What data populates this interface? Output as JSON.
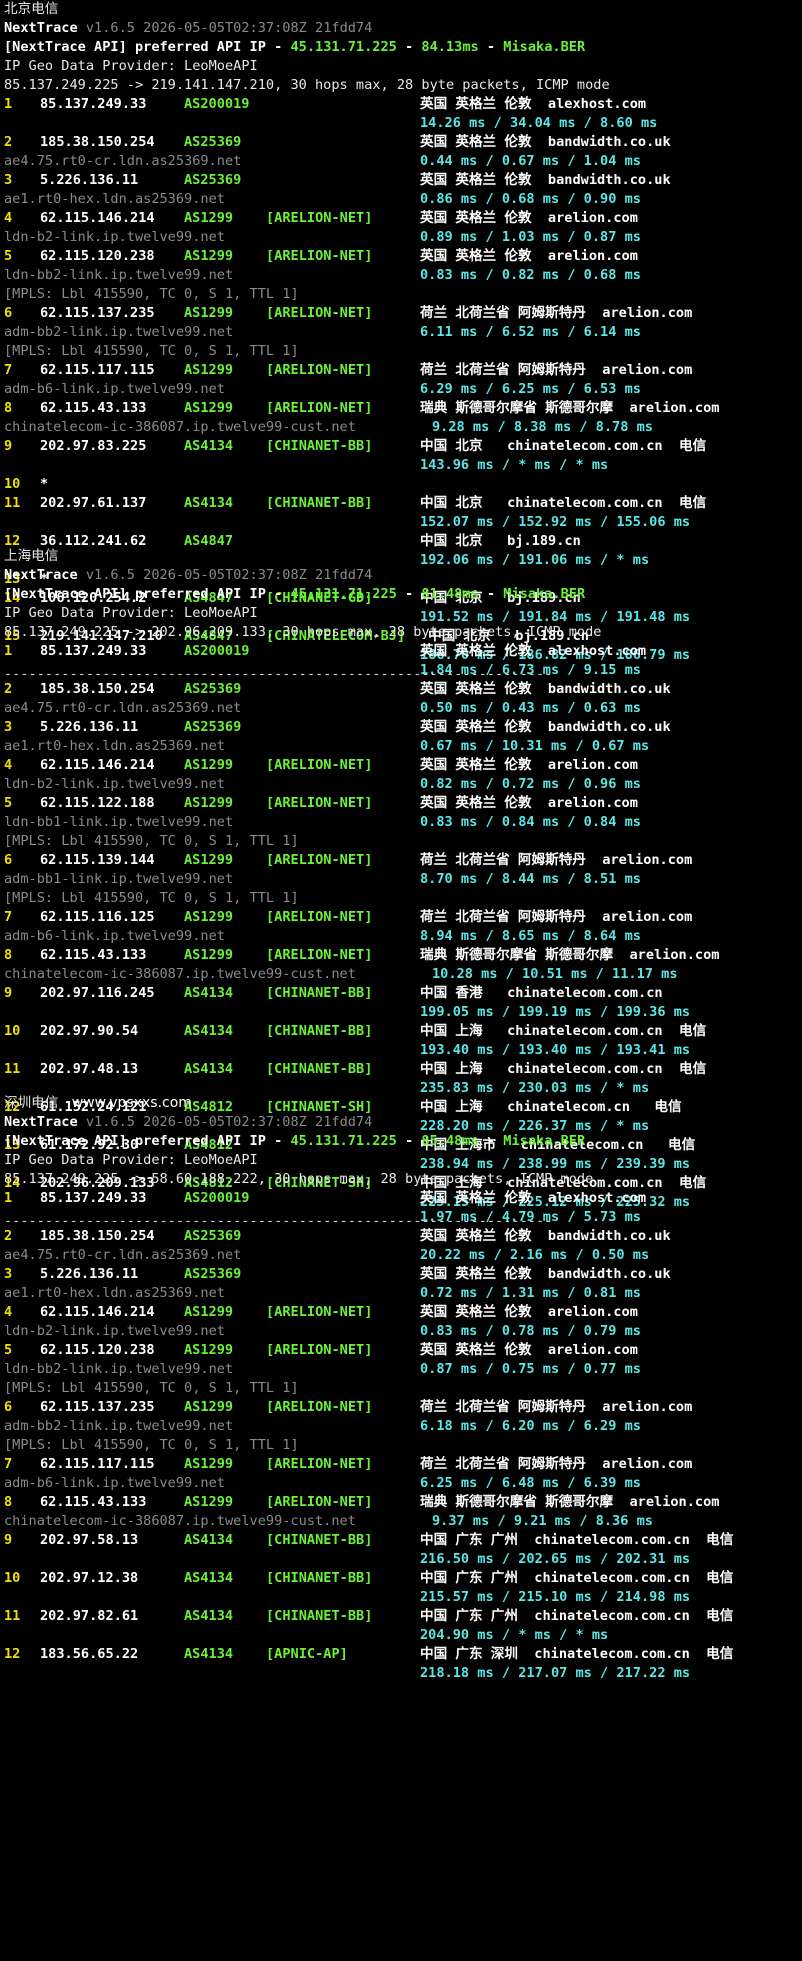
{
  "sections": [
    {
      "title": "北京电信",
      "header_app": "NextTrace",
      "header_meta": "v1.6.5 2026-05-05T02:37:08Z 21fdd74",
      "api_prefix": "[NextTrace API] preferred API IP - ",
      "api_ip": "45.131.71.225",
      "api_dash": " - ",
      "api_ms": "84.13ms",
      "api_dash2": " - ",
      "api_node": "Misaka.BER",
      "geo_provider": "IP Geo Data Provider: LeoMoeAPI",
      "trace_line": "85.137.249.225 -> 219.141.147.210, 30 hops max, 28 byte packets, ICMP mode",
      "hops": [
        {
          "n": "1",
          "ip": "85.137.249.33",
          "as": "AS200019",
          "net": "",
          "geo": "英国 英格兰 伦敦  alexhost.com",
          "rtt": "14.26 ms / 34.04 ms / 8.60 ms",
          "host": ""
        },
        {
          "n": "2",
          "ip": "185.38.150.254",
          "as": "AS25369",
          "net": "",
          "geo": "英国 英格兰 伦敦  bandwidth.co.uk",
          "rtt": "0.44 ms / 0.67 ms / 1.04 ms",
          "host": "ae4.75.rt0-cr.ldn.as25369.net"
        },
        {
          "n": "3",
          "ip": "5.226.136.11",
          "as": "AS25369",
          "net": "",
          "geo": "英国 英格兰 伦敦  bandwidth.co.uk",
          "rtt": "0.86 ms / 0.68 ms / 0.90 ms",
          "host": "ae1.rt0-hex.ldn.as25369.net"
        },
        {
          "n": "4",
          "ip": "62.115.146.214",
          "as": "AS1299",
          "net": "[ARELION-NET]",
          "geo": "英国 英格兰 伦敦  arelion.com",
          "rtt": "0.89 ms / 1.03 ms / 0.87 ms",
          "host": "ldn-b2-link.ip.twelve99.net"
        },
        {
          "n": "5",
          "ip": "62.115.120.238",
          "as": "AS1299",
          "net": "[ARELION-NET]",
          "geo": "英国 英格兰 伦敦  arelion.com",
          "rtt": "0.83 ms / 0.82 ms / 0.68 ms",
          "host": "ldn-bb2-link.ip.twelve99.net",
          "mpls": "[MPLS: Lbl 415590, TC 0, S 1, TTL 1]"
        },
        {
          "n": "6",
          "ip": "62.115.137.235",
          "as": "AS1299",
          "net": "[ARELION-NET]",
          "geo": "荷兰 北荷兰省 阿姆斯特丹  arelion.com",
          "rtt": "6.11 ms / 6.52 ms / 6.14 ms",
          "host": "adm-bb2-link.ip.twelve99.net",
          "mpls": "[MPLS: Lbl 415590, TC 0, S 1, TTL 1]"
        },
        {
          "n": "7",
          "ip": "62.115.117.115",
          "as": "AS1299",
          "net": "[ARELION-NET]",
          "geo": "荷兰 北荷兰省 阿姆斯特丹  arelion.com",
          "rtt": "6.29 ms / 6.25 ms / 6.53 ms",
          "host": "adm-b6-link.ip.twelve99.net"
        },
        {
          "n": "8",
          "ip": "62.115.43.133",
          "as": "AS1299",
          "net": "[ARELION-NET]",
          "geo": "瑞典 斯德哥尔摩省 斯德哥尔摩  arelion.com",
          "rtt": "9.28 ms / 8.38 ms / 8.78 ms",
          "host": "chinatelecom-ic-386087.ip.twelve99-cust.net",
          "inline": true
        },
        {
          "n": "9",
          "ip": "202.97.83.225",
          "as": "AS4134",
          "net": "[CHINANET-BB]",
          "geo": "中国 北京   chinatelecom.com.cn  电信",
          "rtt": "143.96 ms / * ms / * ms",
          "host": ""
        },
        {
          "n": "10",
          "ip": "*",
          "as": "",
          "net": "",
          "geo": "",
          "rtt": "",
          "host": ""
        },
        {
          "n": "11",
          "ip": "202.97.61.137",
          "as": "AS4134",
          "net": "[CHINANET-BB]",
          "geo": "中国 北京   chinatelecom.com.cn  电信",
          "rtt": "152.07 ms / 152.92 ms / 155.06 ms",
          "host": ""
        },
        {
          "n": "12",
          "ip": "36.112.241.62",
          "as": "AS4847",
          "net": "",
          "geo": "中国 北京   bj.189.cn",
          "rtt": "192.06 ms / 191.06 ms / * ms",
          "host": ""
        },
        {
          "n": "13",
          "ip": "*",
          "as": "",
          "net": "",
          "geo": "",
          "rtt": "",
          "host": ""
        },
        {
          "n": "14",
          "ip": "106.120.254.2",
          "as": "AS4847",
          "net": "[CHINANET-GD]",
          "geo": "中国 北京   bj.189.cn",
          "rtt": "191.52 ms / 191.84 ms / 191.48 ms",
          "host": ""
        },
        {
          "n": "15",
          "ip": "219.141.147.210",
          "as": "AS4847",
          "net": "[CHINATELECOM-BJ]",
          "geo": " 中国 北京   bj.189.cn",
          "rtt": "186.70 ms / 186.82 ms / 186.79 ms",
          "host": ""
        }
      ]
    },
    {
      "title": "上海电信",
      "header_app": "NextTrace",
      "header_meta": "v1.6.5 2026-05-05T02:37:08Z 21fdd74",
      "api_prefix": "[NextTrace API] preferred API IP - ",
      "api_ip": "45.131.71.225",
      "api_dash": " - ",
      "api_ms": "81.48ms",
      "api_dash2": " - ",
      "api_node": "Misaka.BER",
      "geo_provider": "IP Geo Data Provider: LeoMoeAPI",
      "trace_line": "85.137.249.225 -> 202.96.209.133, 30 hops max, 28 byte packets, ICMP mode",
      "hops": [
        {
          "n": "1",
          "ip": "85.137.249.33",
          "as": "AS200019",
          "net": "",
          "geo": "英国 英格兰 伦敦  alexhost.com",
          "rtt": "1.84 ms / 6.73 ms / 9.15 ms",
          "host": ""
        },
        {
          "n": "2",
          "ip": "185.38.150.254",
          "as": "AS25369",
          "net": "",
          "geo": "英国 英格兰 伦敦  bandwidth.co.uk",
          "rtt": "0.50 ms / 0.43 ms / 0.63 ms",
          "host": "ae4.75.rt0-cr.ldn.as25369.net"
        },
        {
          "n": "3",
          "ip": "5.226.136.11",
          "as": "AS25369",
          "net": "",
          "geo": "英国 英格兰 伦敦  bandwidth.co.uk",
          "rtt": "0.67 ms / 10.31 ms / 0.67 ms",
          "host": "ae1.rt0-hex.ldn.as25369.net"
        },
        {
          "n": "4",
          "ip": "62.115.146.214",
          "as": "AS1299",
          "net": "[ARELION-NET]",
          "geo": "英国 英格兰 伦敦  arelion.com",
          "rtt": "0.82 ms / 0.72 ms / 0.96 ms",
          "host": "ldn-b2-link.ip.twelve99.net"
        },
        {
          "n": "5",
          "ip": "62.115.122.188",
          "as": "AS1299",
          "net": "[ARELION-NET]",
          "geo": "英国 英格兰 伦敦  arelion.com",
          "rtt": "0.83 ms / 0.84 ms / 0.84 ms",
          "host": "ldn-bb1-link.ip.twelve99.net",
          "mpls": "[MPLS: Lbl 415590, TC 0, S 1, TTL 1]"
        },
        {
          "n": "6",
          "ip": "62.115.139.144",
          "as": "AS1299",
          "net": "[ARELION-NET]",
          "geo": "荷兰 北荷兰省 阿姆斯特丹  arelion.com",
          "rtt": "8.70 ms / 8.44 ms / 8.51 ms",
          "host": "adm-bb1-link.ip.twelve99.net",
          "mpls": "[MPLS: Lbl 415590, TC 0, S 1, TTL 1]"
        },
        {
          "n": "7",
          "ip": "62.115.116.125",
          "as": "AS1299",
          "net": "[ARELION-NET]",
          "geo": "荷兰 北荷兰省 阿姆斯特丹  arelion.com",
          "rtt": "8.94 ms / 8.65 ms / 8.64 ms",
          "host": "adm-b6-link.ip.twelve99.net"
        },
        {
          "n": "8",
          "ip": "62.115.43.133",
          "as": "AS1299",
          "net": "[ARELION-NET]",
          "geo": "瑞典 斯德哥尔摩省 斯德哥尔摩  arelion.com",
          "rtt": "10.28 ms / 10.51 ms / 11.17 ms",
          "host": "chinatelecom-ic-386087.ip.twelve99-cust.net",
          "inline": true
        },
        {
          "n": "9",
          "ip": "202.97.116.245",
          "as": "AS4134",
          "net": "[CHINANET-BB]",
          "geo": "中国 香港   chinatelecom.com.cn",
          "rtt": "199.05 ms / 199.19 ms / 199.36 ms",
          "host": ""
        },
        {
          "n": "10",
          "ip": "202.97.90.54",
          "as": "AS4134",
          "net": "[CHINANET-BB]",
          "geo": "中国 上海   chinatelecom.com.cn  电信",
          "rtt": "193.40 ms / 193.40 ms / 193.41 ms",
          "host": ""
        },
        {
          "n": "11",
          "ip": "202.97.48.13",
          "as": "AS4134",
          "net": "[CHINANET-BB]",
          "geo": "中国 上海   chinatelecom.com.cn  电信",
          "rtt": "235.83 ms / 230.03 ms / * ms",
          "host": ""
        },
        {
          "n": "12",
          "ip": "61.152.24.121",
          "as": "AS4812",
          "net": "[CHINANET-SH]",
          "geo": "中国 上海   chinatelecom.cn   电信",
          "rtt": "228.20 ms / 226.37 ms / * ms",
          "host": ""
        },
        {
          "n": "13",
          "ip": "61.172.92.30",
          "as": "AS4812",
          "net": "",
          "geo": "中国 上海市   chinatelecom.cn   电信",
          "rtt": "238.94 ms / 238.99 ms / 239.39 ms",
          "host": ""
        },
        {
          "n": "14",
          "ip": "202.96.209.133",
          "as": "AS4812",
          "net": "[CHINANET-SH]",
          "geo": "中国 上海   chinatelecom.com.cn  电信",
          "rtt": "225.15 ms / 225.12 ms / 225.32 ms",
          "host": ""
        }
      ]
    },
    {
      "title": "深圳电信",
      "watermark": "www.vpsxxs.com",
      "header_app": "NextTrace",
      "header_meta": "v1.6.5 2026-05-05T02:37:08Z 21fdd74",
      "api_prefix": "[NextTrace API] preferred API IP - ",
      "api_ip": "45.131.71.225",
      "api_dash": " - ",
      "api_ms": "85.48ms",
      "api_dash2": " - ",
      "api_node": "Misaka.BER",
      "geo_provider": "IP Geo Data Provider: LeoMoeAPI",
      "trace_line": "85.137.249.225 -> 58.60.188.222, 30 hops max, 28 byte packets, ICMP mode",
      "hops": [
        {
          "n": "1",
          "ip": "85.137.249.33",
          "as": "AS200019",
          "net": "",
          "geo": "英国 英格兰 伦敦  alexhost.com",
          "rtt": "1.97 ms / 4.79 ms / 5.73 ms",
          "host": ""
        },
        {
          "n": "2",
          "ip": "185.38.150.254",
          "as": "AS25369",
          "net": "",
          "geo": "英国 英格兰 伦敦  bandwidth.co.uk",
          "rtt": "20.22 ms / 2.16 ms / 0.50 ms",
          "host": "ae4.75.rt0-cr.ldn.as25369.net"
        },
        {
          "n": "3",
          "ip": "5.226.136.11",
          "as": "AS25369",
          "net": "",
          "geo": "英国 英格兰 伦敦  bandwidth.co.uk",
          "rtt": "0.72 ms / 1.31 ms / 0.81 ms",
          "host": "ae1.rt0-hex.ldn.as25369.net"
        },
        {
          "n": "4",
          "ip": "62.115.146.214",
          "as": "AS1299",
          "net": "[ARELION-NET]",
          "geo": "英国 英格兰 伦敦  arelion.com",
          "rtt": "0.83 ms / 0.78 ms / 0.79 ms",
          "host": "ldn-b2-link.ip.twelve99.net"
        },
        {
          "n": "5",
          "ip": "62.115.120.238",
          "as": "AS1299",
          "net": "[ARELION-NET]",
          "geo": "英国 英格兰 伦敦  arelion.com",
          "rtt": "0.87 ms / 0.75 ms / 0.77 ms",
          "host": "ldn-bb2-link.ip.twelve99.net",
          "mpls": "[MPLS: Lbl 415590, TC 0, S 1, TTL 1]"
        },
        {
          "n": "6",
          "ip": "62.115.137.235",
          "as": "AS1299",
          "net": "[ARELION-NET]",
          "geo": "荷兰 北荷兰省 阿姆斯特丹  arelion.com",
          "rtt": "6.18 ms / 6.20 ms / 6.29 ms",
          "host": "adm-bb2-link.ip.twelve99.net",
          "mpls": "[MPLS: Lbl 415590, TC 0, S 1, TTL 1]"
        },
        {
          "n": "7",
          "ip": "62.115.117.115",
          "as": "AS1299",
          "net": "[ARELION-NET]",
          "geo": "荷兰 北荷兰省 阿姆斯特丹  arelion.com",
          "rtt": "6.25 ms / 6.48 ms / 6.39 ms",
          "host": "adm-b6-link.ip.twelve99.net"
        },
        {
          "n": "8",
          "ip": "62.115.43.133",
          "as": "AS1299",
          "net": "[ARELION-NET]",
          "geo": "瑞典 斯德哥尔摩省 斯德哥尔摩  arelion.com",
          "rtt": "9.37 ms / 9.21 ms / 8.36 ms",
          "host": "chinatelecom-ic-386087.ip.twelve99-cust.net",
          "inline": true
        },
        {
          "n": "9",
          "ip": "202.97.58.13",
          "as": "AS4134",
          "net": "[CHINANET-BB]",
          "geo": "中国 广东 广州  chinatelecom.com.cn  电信",
          "rtt": "216.50 ms / 202.65 ms / 202.31 ms",
          "host": ""
        },
        {
          "n": "10",
          "ip": "202.97.12.38",
          "as": "AS4134",
          "net": "[CHINANET-BB]",
          "geo": "中国 广东 广州  chinatelecom.com.cn  电信",
          "rtt": "215.57 ms / 215.10 ms / 214.98 ms",
          "host": ""
        },
        {
          "n": "11",
          "ip": "202.97.82.61",
          "as": "AS4134",
          "net": "[CHINANET-BB]",
          "geo": "中国 广东 广州  chinatelecom.com.cn  电信",
          "rtt": "204.90 ms / * ms / * ms",
          "host": ""
        },
        {
          "n": "12",
          "ip": "183.56.65.22",
          "as": "AS4134",
          "net": "[APNIC-AP]",
          "geo": "中国 广东 深圳  chinatelecom.com.cn  电信",
          "rtt": "218.18 ms / 217.07 ms / 217.22 ms",
          "host": ""
        }
      ]
    }
  ],
  "separator": "-------------------------------------------------------------------"
}
